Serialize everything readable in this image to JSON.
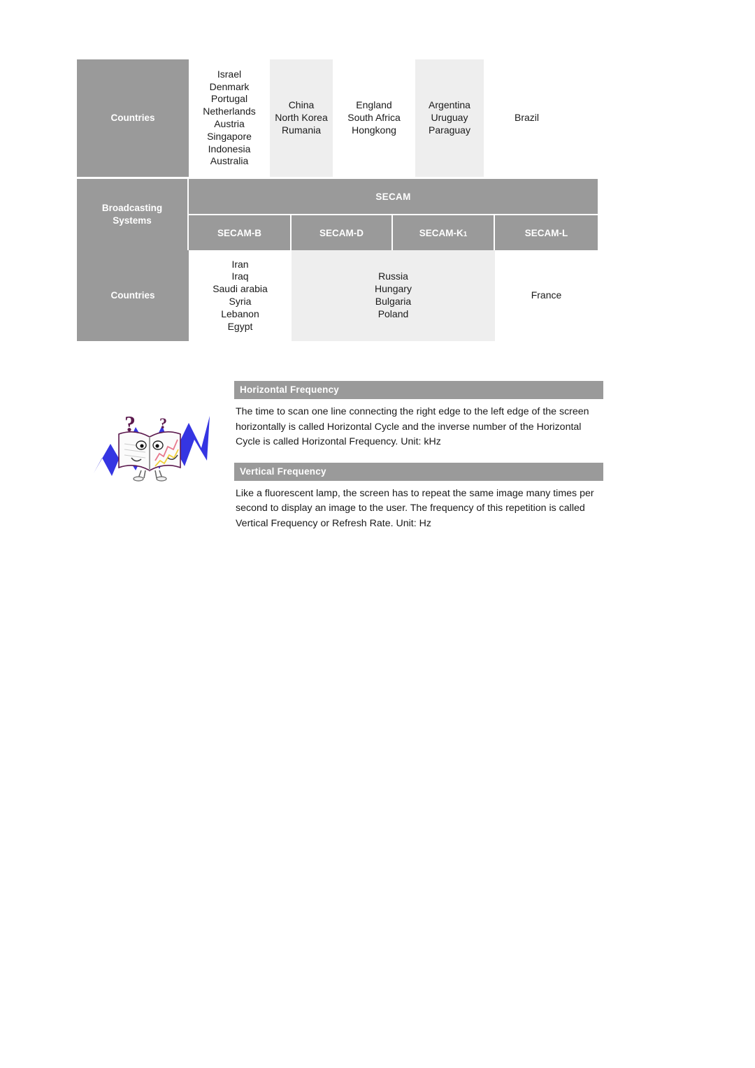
{
  "colors": {
    "gray_header": "#9a9a9a",
    "cell_shade": "#eeeeee",
    "cell_plain": "#ffffff",
    "text": "#1a1a1a",
    "header_text": "#ffffff",
    "illustration_blue": "#2a2ae0",
    "illustration_purple": "#5c1a4e"
  },
  "table": {
    "row1": {
      "label": "Countries",
      "cells": [
        {
          "text": "Israel\nDenmark\nPortugal\nNetherlands\nAustria\nSingapore\nIndonesia\nAustralia",
          "shaded": false
        },
        {
          "text": "China\nNorth Korea\nRumania",
          "shaded": true
        },
        {
          "text": "England\nSouth Africa\nHongkong",
          "shaded": false
        },
        {
          "text": "Argentina\nUruguay\nParaguay",
          "shaded": true
        },
        {
          "text": "Brazil",
          "shaded": false
        }
      ]
    },
    "secam": {
      "label": "Broadcasting\nSystems",
      "title": "SECAM",
      "subsystems": [
        {
          "name": "SECAM-B",
          "base": "SECAM-B",
          "sub": ""
        },
        {
          "name": "SECAM-D",
          "base": "SECAM-D",
          "sub": ""
        },
        {
          "name": "SECAM-K1",
          "base": "SECAM-K",
          "sub": "1"
        },
        {
          "name": "SECAM-L",
          "base": "SECAM-L",
          "sub": ""
        }
      ]
    },
    "row3": {
      "label": "Countries",
      "cells": [
        {
          "text": "Iran\nIraq\nSaudi arabia\nSyria\nLebanon\nEgypt",
          "shaded": false
        },
        {
          "text": "Russia\nHungary\nBulgaria\nPoland",
          "shaded": true
        },
        {
          "text": "France",
          "shaded": false
        }
      ]
    }
  },
  "panels": [
    {
      "title": "Horizontal Frequency",
      "body": "The time to scan one line connecting the right edge to the left edge of the screen horizontally is called Horizontal Cycle and the inverse number of the Horizontal Cycle is called Horizontal Frequency. Unit: kHz"
    },
    {
      "title": "Vertical Frequency",
      "body": "Like a fluorescent lamp, the screen has to repeat the same image many times per second to display an image to the user. The frequency of this repetition is called Vertical Frequency or Refresh Rate. Unit: Hz"
    }
  ],
  "illustration": {
    "name": "open-book-question-mark-illustration",
    "description": "Cartoon open book character with two question marks and blue zigzag"
  }
}
